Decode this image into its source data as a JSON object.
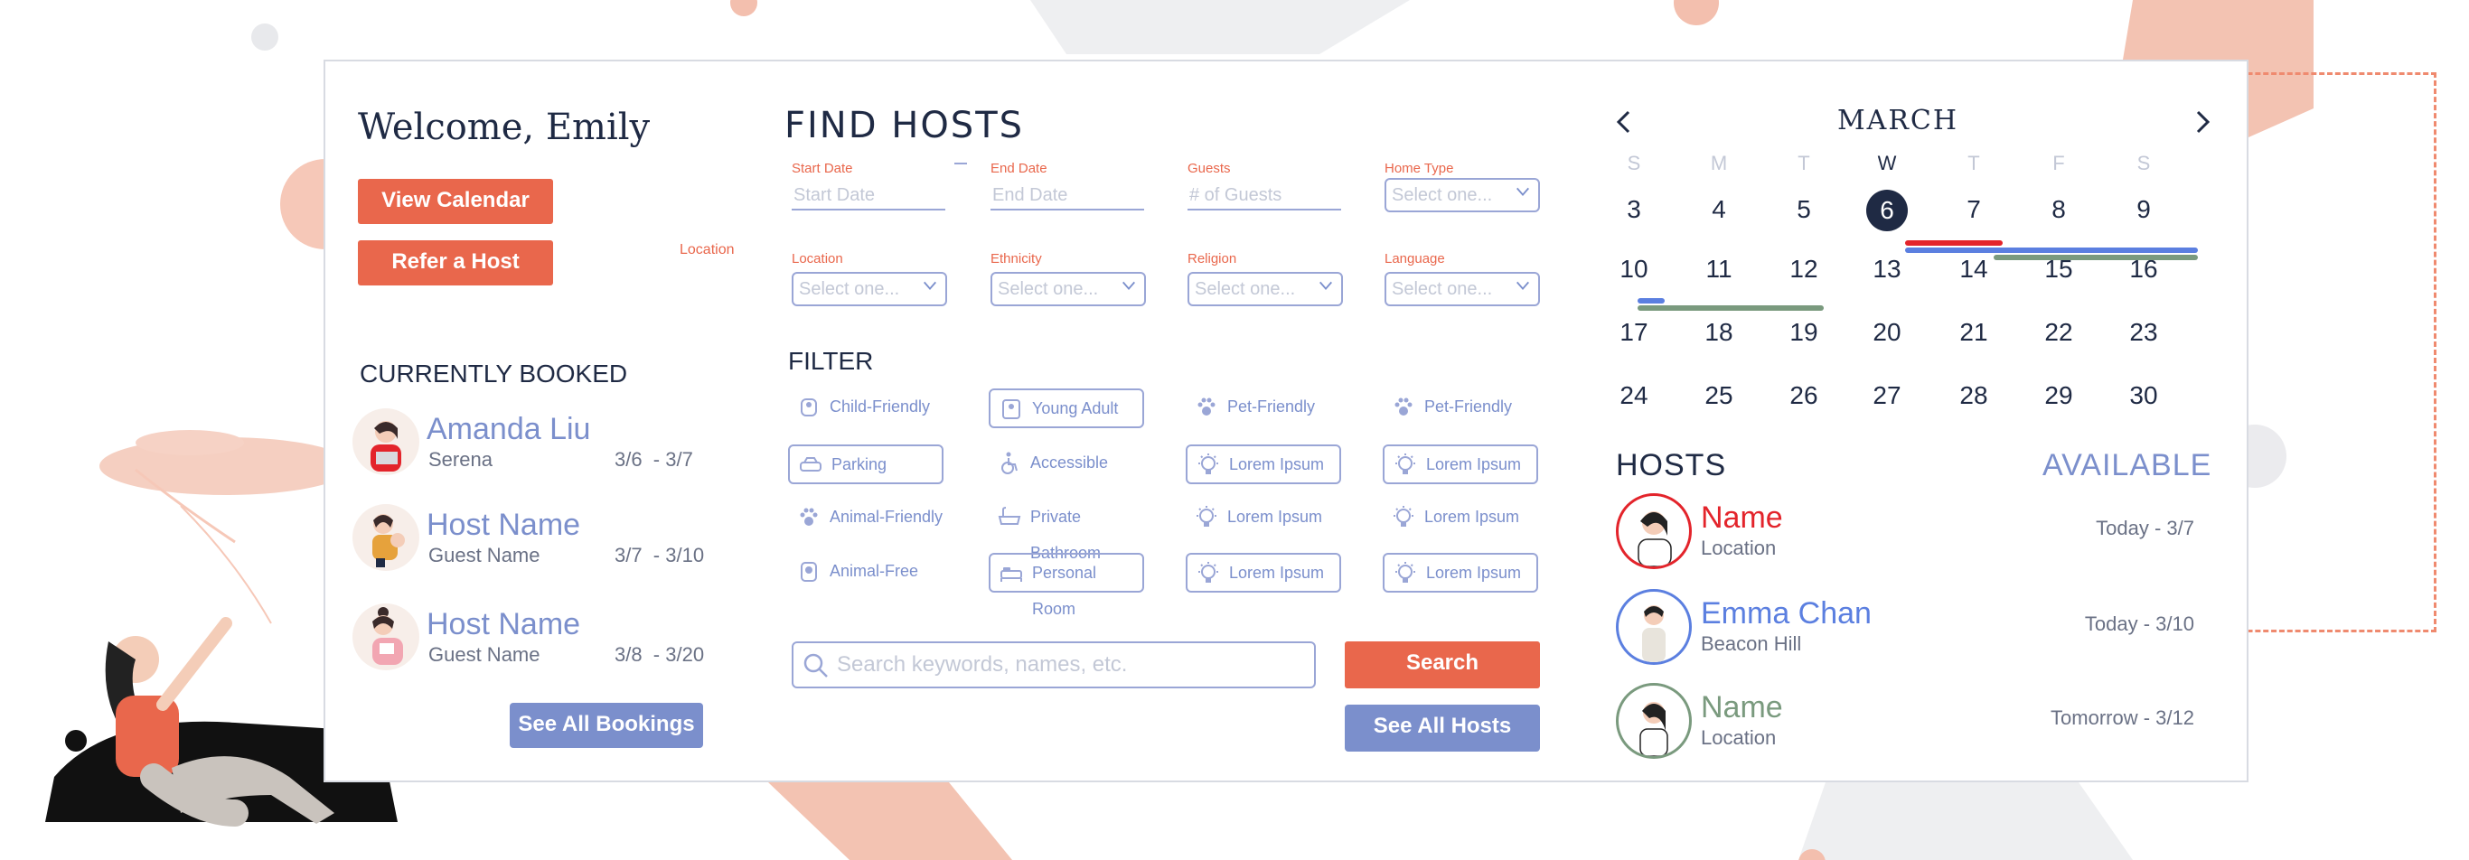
{
  "colors": {
    "accent_orange": "#e9674c",
    "accent_blue": "#7b8fcc",
    "navy": "#1f2a44",
    "red_bar": "#e3242b",
    "blue_bar": "#5b7fe0",
    "green_bar": "#7a9a7e"
  },
  "left": {
    "welcome": "Welcome, Emily",
    "view_calendar": "View Calendar",
    "refer_host": "Refer a Host",
    "location_tag": "Location",
    "currently_booked": "CURRENTLY BOOKED",
    "bookings": [
      {
        "host": "Amanda Liu",
        "guest": "Serena",
        "dates": "3/6  - 3/7"
      },
      {
        "host": "Host Name",
        "guest": "Guest Name",
        "dates": "3/7  - 3/10"
      },
      {
        "host": "Host Name",
        "guest": "Guest Name",
        "dates": "3/8  - 3/20"
      }
    ],
    "see_all_bookings": "See All Bookings"
  },
  "find": {
    "title": "FIND HOSTS",
    "start_date": {
      "label": "Start Date",
      "placeholder": "Start Date"
    },
    "end_date": {
      "label": "End Date",
      "placeholder": "End Date"
    },
    "guests": {
      "label": "Guests",
      "placeholder": "# of Guests"
    },
    "home_type": {
      "label": "Home Type",
      "value": "Select one..."
    },
    "location": {
      "label": "Location",
      "value": "Select one..."
    },
    "ethnicity": {
      "label": "Ethnicity",
      "value": "Select one..."
    },
    "religion": {
      "label": "Religion",
      "value": "Select one..."
    },
    "language": {
      "label": "Language",
      "value": "Select one..."
    },
    "filter_title": "FILTER",
    "filters": [
      {
        "label": "Child-Friendly",
        "icon": "child-icon",
        "boxed": false
      },
      {
        "label": "Young Adult",
        "icon": "young-adult-icon",
        "boxed": true
      },
      {
        "label": "Pet-Friendly",
        "icon": "paw-icon",
        "boxed": false
      },
      {
        "label": "Pet-Friendly",
        "icon": "paw-icon",
        "boxed": false
      },
      {
        "label": "Parking",
        "icon": "car-icon",
        "boxed": true
      },
      {
        "label": "Accessible",
        "icon": "wheelchair-icon",
        "boxed": false
      },
      {
        "label": "Lorem Ipsum",
        "icon": "lightbulb-icon",
        "boxed": true
      },
      {
        "label": "Lorem Ipsum",
        "icon": "lightbulb-icon",
        "boxed": true
      },
      {
        "label": "Animal-Friendly",
        "icon": "paw-icon",
        "boxed": false
      },
      {
        "label": "Private Bathroom",
        "icon": "bathtub-icon",
        "boxed": false
      },
      {
        "label": "Lorem Ipsum",
        "icon": "lightbulb-icon",
        "boxed": false
      },
      {
        "label": "Lorem Ipsum",
        "icon": "lightbulb-icon",
        "boxed": false
      },
      {
        "label": "Animal-Free",
        "icon": "no-animal-icon",
        "boxed": false
      },
      {
        "label": "Personal Room",
        "icon": "bed-icon",
        "boxed": true
      },
      {
        "label": "Lorem Ipsum",
        "icon": "lightbulb-icon",
        "boxed": true
      },
      {
        "label": "Lorem Ipsum",
        "icon": "lightbulb-icon",
        "boxed": true
      }
    ],
    "search_placeholder": "Search keywords, names, etc.",
    "search_button": "Search",
    "see_all_hosts": "See All Hosts"
  },
  "calendar": {
    "month": "MARCH",
    "weekdays": [
      "S",
      "M",
      "T",
      "W",
      "T",
      "F",
      "S"
    ],
    "active_weekday_index": 3,
    "today": 6,
    "weeks": [
      [
        3,
        4,
        5,
        6,
        7,
        8,
        9
      ],
      [
        10,
        11,
        12,
        13,
        14,
        15,
        16
      ],
      [
        17,
        18,
        19,
        20,
        21,
        22,
        23
      ],
      [
        24,
        25,
        26,
        27,
        28,
        29,
        30
      ]
    ]
  },
  "hosts": {
    "title": "HOSTS",
    "available": "AVAILABLE",
    "items": [
      {
        "name": "Name",
        "location": "Location",
        "dates": "Today - 3/7",
        "color": "#e3242b"
      },
      {
        "name": "Emma Chan",
        "location": "Beacon Hill",
        "dates": "Today - 3/10",
        "color": "#5b7fe0"
      },
      {
        "name": "Name",
        "location": "Location",
        "dates": "Tomorrow - 3/12",
        "color": "#7a9a7e"
      }
    ]
  }
}
